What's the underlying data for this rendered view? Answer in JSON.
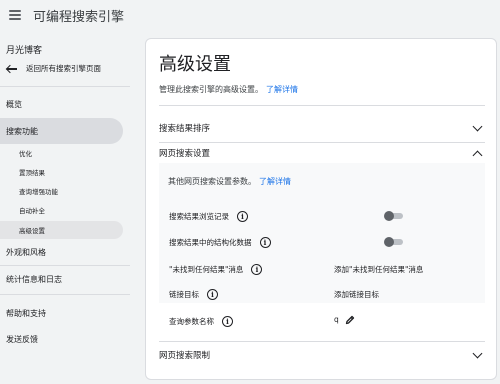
{
  "app": {
    "title": "可编程搜索引擎"
  },
  "sidebar": {
    "site_name": "月光博客",
    "back_label": "返回所有搜索引擎页面",
    "items": {
      "overview": "概览",
      "search_features": "搜索功能",
      "look_feel": "外观和风格",
      "stats_logs": "统计信息和日志",
      "help": "帮助和支持",
      "feedback": "发送反馈"
    },
    "sub_items": {
      "refinements": "优化",
      "promotions": "置顶结果",
      "query_enhancements": "查询增强功能",
      "autocomplete": "自动补全",
      "advanced": "高级设置"
    }
  },
  "main": {
    "title": "高级设置",
    "description": "管理此搜索引擎的高级设置。",
    "learn_more": "了解详情",
    "sections": {
      "sort": "搜索结果排序",
      "web_search": "网页搜索设置",
      "web_restrict": "网页搜索限制"
    },
    "web_search": {
      "description": "其他网页搜索设置参数。",
      "learn_more": "了解详情",
      "rows": {
        "browse_history": "搜索结果浏览记录",
        "structured_data": "搜索结果中的结构化数据",
        "no_results_msg": "\"未找到任何结果\"消息",
        "link_target": "链接目标",
        "query_param": "查询参数名称"
      },
      "values": {
        "add_no_results": "添加\"未找到任何结果\"消息",
        "add_link_target": "添加链接目标",
        "query_param_value": "q"
      },
      "toggles": {
        "browse_history": false,
        "structured_data": false
      }
    }
  }
}
